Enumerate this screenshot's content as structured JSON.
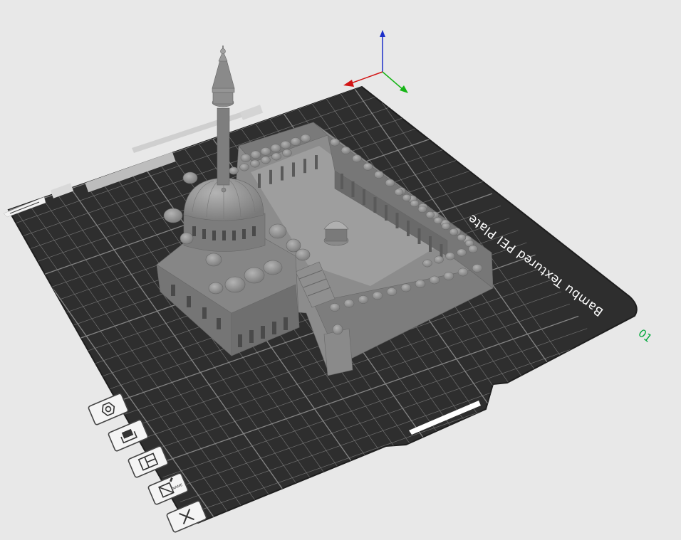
{
  "viewport": {
    "background_color": "#e8e8e8",
    "plate_color": "#2e2e2e",
    "grid_color": "#8a8a8a",
    "model_color": "#8c8c8c",
    "plate_label": "Bambu Textured PEI Plate",
    "plate_index": "01",
    "axes": {
      "x_color": "#d21414",
      "y_color": "#16b516",
      "z_color": "#1c2fc9"
    }
  },
  "toolbar": {
    "buttons": [
      {
        "name": "auto-orient-button",
        "icon": "hexagon-nut-icon"
      },
      {
        "name": "arrange-button",
        "icon": "tray-icon"
      },
      {
        "name": "layout-button",
        "icon": "layout-panels-icon"
      },
      {
        "name": "plate-name-button",
        "icon": "plate-name-icon",
        "label": "NAME"
      },
      {
        "name": "remove-plate-button",
        "icon": "close-icon"
      }
    ]
  }
}
